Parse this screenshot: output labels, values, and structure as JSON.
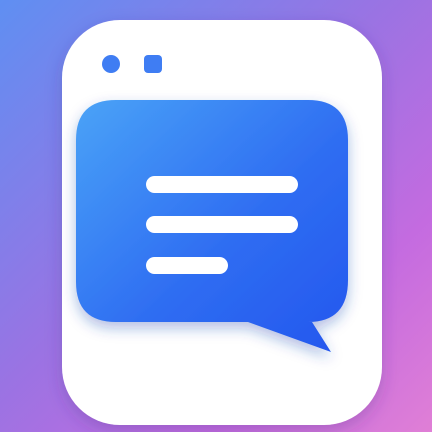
{
  "app_icon": {
    "icon_name": "chat-message-app-icon",
    "window_controls": [
      "circle-dot-icon",
      "square-dot-icon"
    ],
    "bubble_icon": "speech-bubble-icon",
    "text_lines": 3,
    "colors": {
      "background_gradient": [
        "#5f8ff2",
        "#9a73e3",
        "#c46be0",
        "#e07fd6"
      ],
      "card": "#ffffff",
      "window_dot": "#3f7df3",
      "bubble_gradient": [
        "#4aa3f7",
        "#2f6ef2",
        "#2456ee"
      ],
      "bubble_lines": "#ffffff"
    }
  }
}
